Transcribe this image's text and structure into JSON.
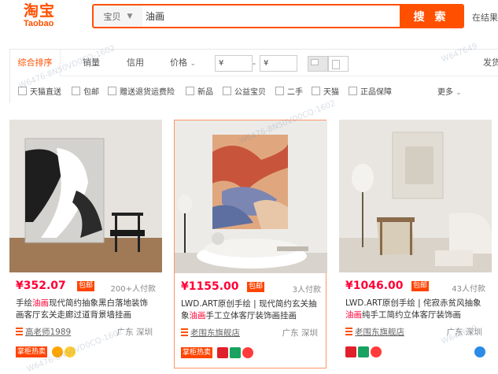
{
  "header": {
    "logo_cn": "淘宝",
    "logo_en": "Taobao",
    "search_scope": "宝贝",
    "search_query": "油画",
    "search_button": "搜 索",
    "in_results": "在结果"
  },
  "sort_bar": {
    "comprehensive": "综合排序",
    "sales": "销量",
    "credit": "信用",
    "price": "价格",
    "price_from_prefix": "¥",
    "price_dash": "-",
    "price_to_prefix": "¥",
    "ship_from": "发货"
  },
  "filters": {
    "items": [
      "天猫直送",
      "包邮",
      "赠送退货运费险",
      "新品",
      "公益宝贝",
      "二手",
      "天猫",
      "正品保障"
    ],
    "more": "更多"
  },
  "products": [
    {
      "price": "¥352.07",
      "free_ship": "包邮",
      "paid": "200+人付款",
      "title_pre": "手绘",
      "title_kw": "油画",
      "title_post": "现代简约抽象黑白落地装饰画客厅玄关走廊过道背景墙挂画",
      "shop": "高老师1989",
      "location": "广东 深圳",
      "hot_badge": "掌柜热卖",
      "ad": ""
    },
    {
      "price": "¥1155.00",
      "free_ship": "包邮",
      "paid": "3人付款",
      "title_pre": "LWD.ART原创手绘 | 现代简约玄关抽象",
      "title_kw": "油画",
      "title_post": "手工立体客厅装饰画挂画",
      "shop": "老围东旗舰店",
      "location": "广东 深圳",
      "hot_badge": "掌柜热卖",
      "ad": ""
    },
    {
      "price": "¥1046.00",
      "free_ship": "包邮",
      "paid": "43人付款",
      "title_pre": "LWD.ART原创手绘 | 侘寂赤贫风抽象",
      "title_kw": "油画",
      "title_post": "纯手工简约立体客厅装饰画",
      "shop": "老围东旗舰店",
      "location": "广东 深圳",
      "hot_badge": "",
      "ad": ""
    }
  ],
  "watermarks": [
    "W6476-8N50VD0CQ-1602",
    "W647649"
  ],
  "colors": {
    "accent": "#ff5000",
    "price": "#ff0036"
  }
}
